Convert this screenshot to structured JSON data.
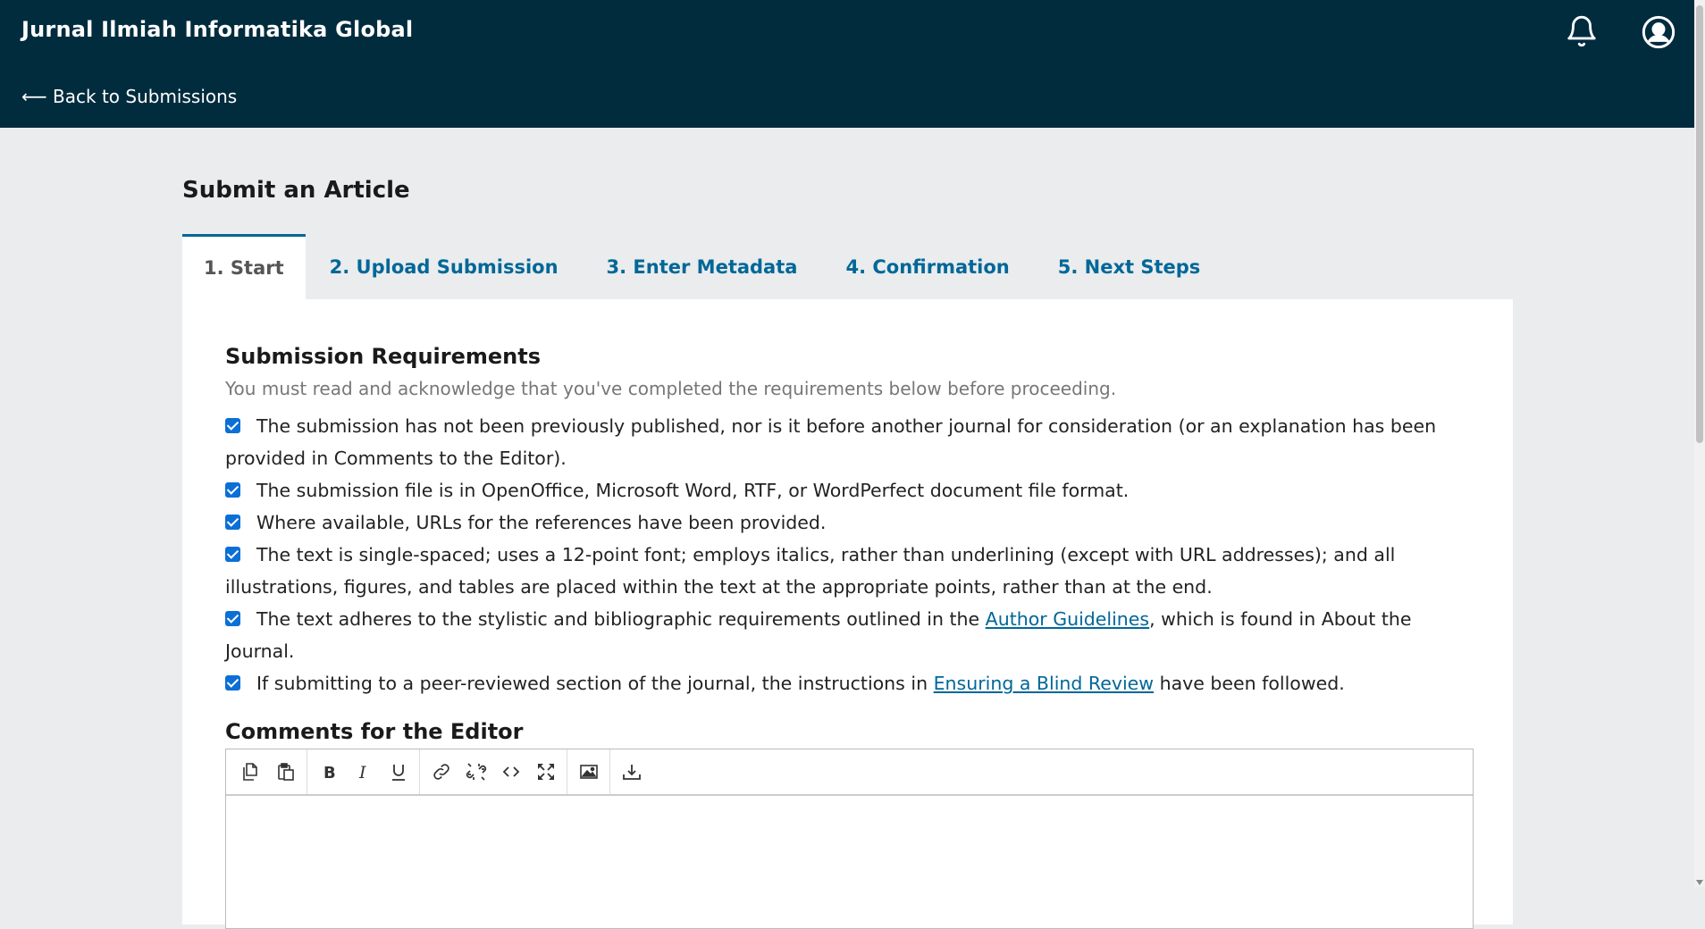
{
  "header": {
    "site_title": "Jurnal Ilmiah Informatika Global",
    "back_link": "⟵ Back to Submissions",
    "bell_icon": "bell-icon",
    "user_icon": "user-account-icon"
  },
  "page": {
    "title": "Submit an Article"
  },
  "tabs": [
    {
      "label": "1. Start",
      "active": true
    },
    {
      "label": "2. Upload Submission"
    },
    {
      "label": "3. Enter Metadata"
    },
    {
      "label": "4. Confirmation"
    },
    {
      "label": "5. Next Steps"
    }
  ],
  "requirements": {
    "title": "Submission Requirements",
    "description": "You must read and acknowledge that you've completed the requirements below before proceeding.",
    "items": [
      {
        "checked": true,
        "text": "The submission has not been previously published, nor is it before another journal for consideration (or an explanation has been provided in Comments to the Editor)."
      },
      {
        "checked": true,
        "text": "The submission file is in OpenOffice, Microsoft Word, RTF, or WordPerfect document file format."
      },
      {
        "checked": true,
        "text": "Where available, URLs for the references have been provided."
      },
      {
        "checked": true,
        "text": "The text is single-spaced; uses a 12-point font; employs italics, rather than underlining (except with URL addresses); and all illustrations, figures, and tables are placed within the text at the appropriate points, rather than at the end."
      },
      {
        "checked": true,
        "text_before": "The text adheres to the stylistic and bibliographic requirements outlined in the ",
        "link": "Author Guidelines",
        "text_after": ", which is found in About the Journal."
      },
      {
        "checked": true,
        "text_before": "If submitting to a peer-reviewed section of the journal, the instructions in ",
        "link": "Ensuring a Blind Review",
        "text_after": " have been followed."
      }
    ]
  },
  "comments": {
    "label": "Comments for the Editor",
    "value": "",
    "toolbar": [
      "copy-icon",
      "paste-icon",
      "bold-icon",
      "italic-icon",
      "underline-icon",
      "link-icon",
      "unlink-icon",
      "code-icon",
      "fullscreen-icon",
      "image-icon",
      "upload-icon"
    ]
  },
  "colors": {
    "header_bg": "#002c3e",
    "link": "#006798",
    "checkbox": "#0b6fd6",
    "page_bg": "#eaeced"
  }
}
